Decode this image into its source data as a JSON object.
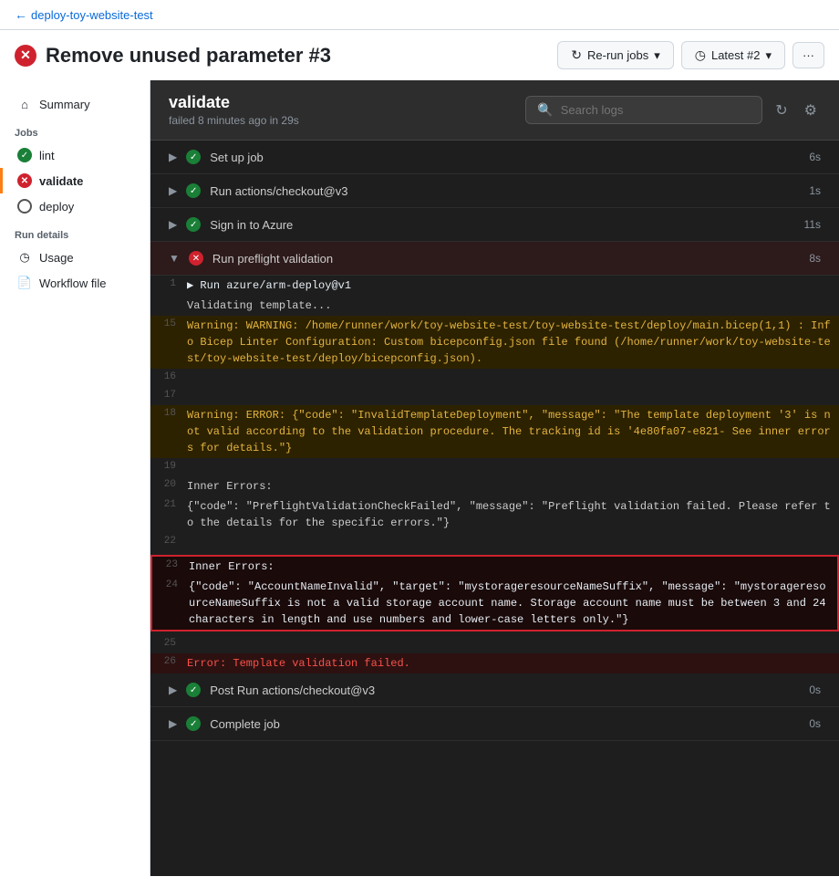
{
  "topbar": {
    "back_text": "deploy-toy-website-test"
  },
  "header": {
    "title": "Remove unused parameter #3",
    "rerun_label": "Re-run jobs",
    "latest_label": "Latest #2",
    "more_label": "···"
  },
  "sidebar": {
    "summary_label": "Summary",
    "jobs_section": "Jobs",
    "jobs": [
      {
        "id": "lint",
        "label": "lint",
        "status": "success"
      },
      {
        "id": "validate",
        "label": "validate",
        "status": "error",
        "active": true
      },
      {
        "id": "deploy",
        "label": "deploy",
        "status": "gray"
      }
    ],
    "run_details_section": "Run details",
    "run_items": [
      {
        "id": "usage",
        "label": "Usage",
        "icon": "clock"
      },
      {
        "id": "workflow",
        "label": "Workflow file",
        "icon": "file"
      }
    ]
  },
  "log_panel": {
    "title": "validate",
    "subtitle": "failed 8 minutes ago in 29s",
    "search_placeholder": "Search logs"
  },
  "jobs": [
    {
      "id": "setup",
      "name": "Set up job",
      "status": "success",
      "duration": "6s",
      "expanded": false
    },
    {
      "id": "checkout",
      "name": "Run actions/checkout@v3",
      "status": "success",
      "duration": "1s",
      "expanded": false
    },
    {
      "id": "azure",
      "name": "Sign in to Azure",
      "status": "success",
      "duration": "11s",
      "expanded": false
    },
    {
      "id": "preflight",
      "name": "Run preflight validation",
      "status": "error",
      "duration": "8s",
      "expanded": true
    }
  ],
  "log_lines": [
    {
      "num": "1",
      "content": "▶ Run azure/arm-deploy@v1",
      "type": "normal"
    },
    {
      "num": "",
      "content": "Validating template...",
      "type": "normal"
    },
    {
      "num": "15",
      "content": "Warning: WARNING: /home/runner/work/toy-website-test/toy-website-test/deploy/main.bicep(1,1) : Info Bicep Linter Configuration: Custom bicepconfig.json file found (/home/runner/work/toy-website-test/toy-website-test/deploy/bicepconfig.json).",
      "type": "warning"
    },
    {
      "num": "16",
      "content": "",
      "type": "normal"
    },
    {
      "num": "17",
      "content": "",
      "type": "normal"
    },
    {
      "num": "18",
      "content": "Warning: ERROR: {\"code\": \"InvalidTemplateDeployment\", \"message\": \"The template deployment '3' is not valid according to the validation procedure. The tracking id is '4e80fa07-e821- See inner errors for details.\"}",
      "type": "warning"
    },
    {
      "num": "19",
      "content": "",
      "type": "normal"
    },
    {
      "num": "20",
      "content": "Inner Errors:",
      "type": "normal"
    },
    {
      "num": "21",
      "content": "{\"code\": \"PreflightValidationCheckFailed\", \"message\": \"Preflight validation failed. Please refer to the details for the specific errors.\"}",
      "type": "normal"
    },
    {
      "num": "22",
      "content": "",
      "type": "normal"
    }
  ],
  "highlighted_lines": [
    {
      "num": "23",
      "content": "Inner Errors:",
      "type": "normal"
    },
    {
      "num": "24",
      "content": "{\"code\": \"AccountNameInvalid\", \"target\": \"mystorageresourceNameSuffix\", \"message\": \"mystorageresourceNameSuffix is not a valid storage account name. Storage account name must be between 3 and 24 characters in length and use numbers and lower-case letters only.\"}",
      "type": "normal"
    }
  ],
  "after_lines": [
    {
      "num": "25",
      "content": "",
      "type": "normal"
    },
    {
      "num": "26",
      "content": "Error: Template validation failed.",
      "type": "error"
    }
  ],
  "bottom_jobs": [
    {
      "id": "post-checkout",
      "name": "Post Run actions/checkout@v3",
      "status": "success",
      "duration": "0s"
    },
    {
      "id": "complete",
      "name": "Complete job",
      "status": "success",
      "duration": "0s"
    }
  ]
}
